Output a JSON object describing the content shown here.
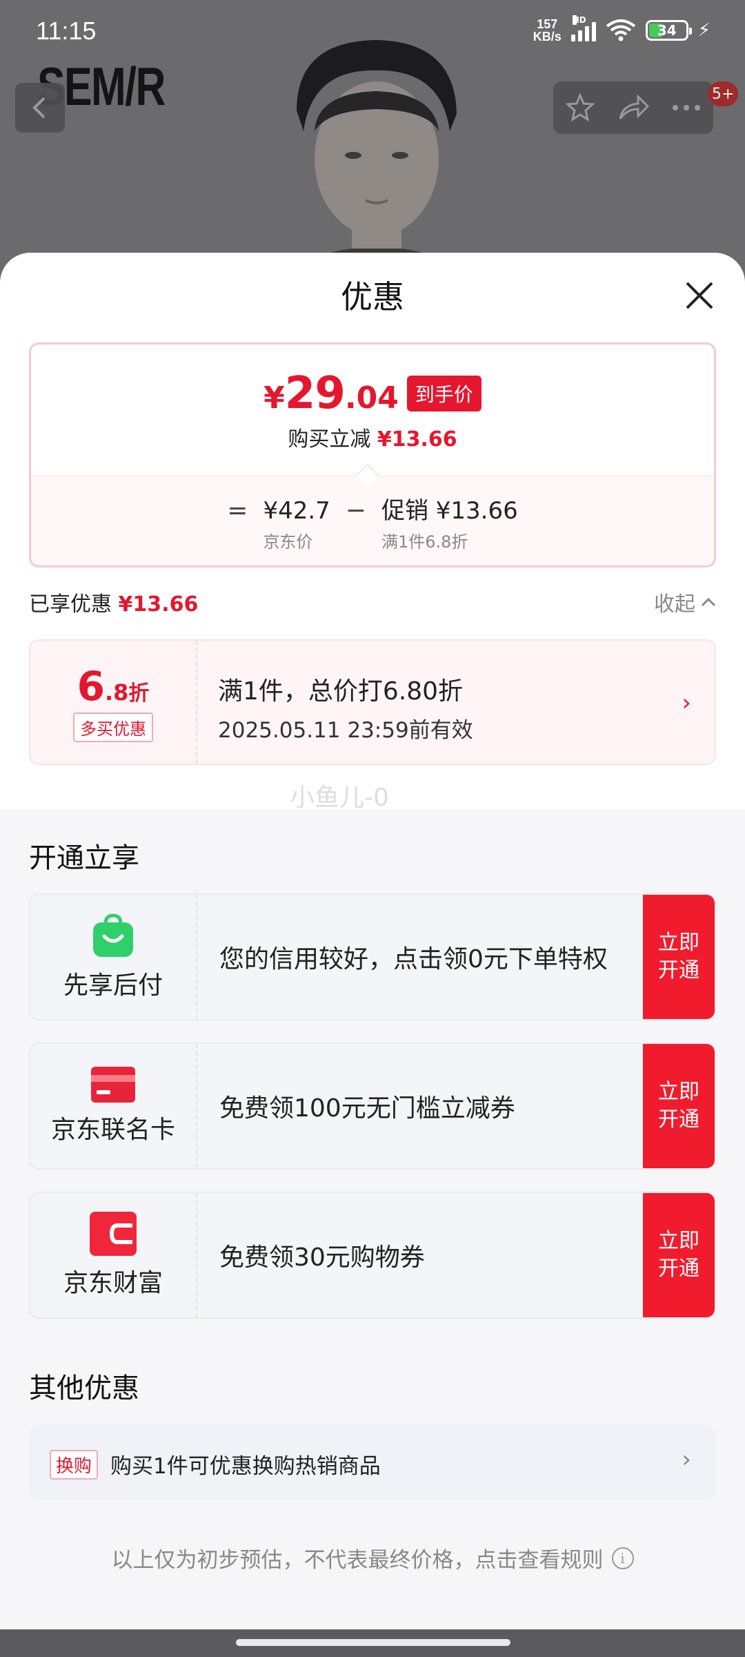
{
  "status_bar": {
    "time": "11:15",
    "net_speed_value": "157",
    "net_speed_unit": "KB/s",
    "signal_label": "HD",
    "battery": "34"
  },
  "background_page": {
    "brand_logo": "SEM/R",
    "message_badge": "5+"
  },
  "sheet": {
    "title": "优惠",
    "price_card": {
      "currency": "¥",
      "final_int": "29",
      "final_dec": ".04",
      "final_tag": "到手价",
      "instant_label": "购买立减",
      "instant_amount": "¥13.66",
      "equals": "=",
      "jd_price": "¥42.7",
      "jd_price_label": "京东价",
      "minus": "−",
      "promo": "促销 ¥13.66",
      "promo_sub": "满1件6.8折"
    },
    "enjoyed": {
      "label": "已享优惠",
      "amount": "¥13.66",
      "collapse": "收起"
    },
    "discount": {
      "rate_int": "6",
      "rate_dec": ".8",
      "rate_unit": "折",
      "tag": "多买优惠",
      "title": "满1件，总价打6.80折",
      "validity": "2025.05.11 23:59前有效"
    },
    "watermark": "小鱼儿-0",
    "open_section": {
      "title": "开通立享",
      "items": [
        {
          "name": "先享后付",
          "desc": "您的信用较好，点击领0元下单特权",
          "button": "立即\n开通",
          "icon": "shopping-bag-icon"
        },
        {
          "name": "京东联名卡",
          "desc": "免费领100元无门槛立减券",
          "button": "立即\n开通",
          "icon": "credit-card-icon"
        },
        {
          "name": "京东财富",
          "desc": "免费领30元购物券",
          "button": "立即\n开通",
          "icon": "wallet-icon"
        }
      ]
    },
    "other_section": {
      "title": "其他优惠",
      "swap_tag": "换购",
      "swap_text": "购买1件可优惠换购热销商品"
    },
    "footer_note": "以上仅为初步预估，不代表最终价格，点击查看规则"
  },
  "colors": {
    "accent_red": "#e4172e",
    "button_red": "#f01c2e",
    "bag_green": "#2fcf6a"
  }
}
